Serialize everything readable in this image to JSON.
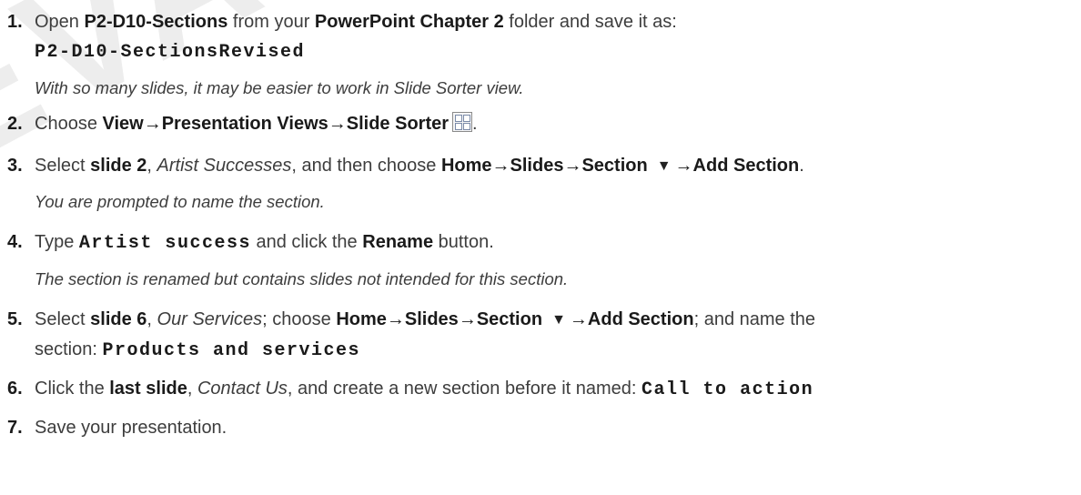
{
  "watermark": "EVALUATION",
  "steps": [
    {
      "num": "1.",
      "segments": [
        {
          "t": "Open "
        },
        {
          "t": "P2-D10-Sections",
          "b": true
        },
        {
          "t": " from your "
        },
        {
          "t": "PowerPoint Chapter 2",
          "b": true
        },
        {
          "t": " folder and save it as:"
        }
      ],
      "line2": "P2-D10-SectionsRevised",
      "note": "With so many slides, it may be easier to work in Slide Sorter view."
    },
    {
      "num": "2.",
      "segments": [
        {
          "t": "Choose "
        },
        {
          "t": "View",
          "b": true
        },
        {
          "t": "→",
          "a": true
        },
        {
          "t": "Presentation Views",
          "b": true
        },
        {
          "t": "→",
          "a": true
        },
        {
          "t": "Slide Sorter",
          "b": true
        }
      ],
      "icon": "slide-sorter-icon",
      "trailing": "."
    },
    {
      "num": "3.",
      "segments": [
        {
          "t": "Select "
        },
        {
          "t": "slide 2",
          "b": true
        },
        {
          "t": ", "
        },
        {
          "t": "Artist Successes",
          "i": true
        },
        {
          "t": ", and then choose "
        },
        {
          "t": "Home",
          "b": true
        },
        {
          "t": "→",
          "a": true
        },
        {
          "t": "Slides",
          "b": true
        },
        {
          "t": "→",
          "a": true
        },
        {
          "t": "Section",
          "b": true
        },
        {
          "t": "▼",
          "tri": true
        },
        {
          "t": "→",
          "a": true
        },
        {
          "t": "Add Section",
          "b": true
        },
        {
          "t": "."
        }
      ],
      "note": "You are prompted to name the section."
    },
    {
      "num": "4.",
      "segments": [
        {
          "t": "Type "
        },
        {
          "t": "Artist success",
          "m": true
        },
        {
          "t": " and click the "
        },
        {
          "t": "Rename",
          "b": true
        },
        {
          "t": " button."
        }
      ],
      "note": "The section is renamed but contains slides not intended for this section."
    },
    {
      "num": "5.",
      "segments": [
        {
          "t": "Select "
        },
        {
          "t": "slide 6",
          "b": true
        },
        {
          "t": ", "
        },
        {
          "t": "Our Services",
          "i": true
        },
        {
          "t": "; choose "
        },
        {
          "t": "Home",
          "b": true
        },
        {
          "t": "→",
          "a": true
        },
        {
          "t": "Slides",
          "b": true
        },
        {
          "t": "→",
          "a": true
        },
        {
          "t": "Section",
          "b": true
        },
        {
          "t": "▼",
          "tri": true
        },
        {
          "t": "→",
          "a": true
        },
        {
          "t": "Add Section",
          "b": true
        },
        {
          "t": "; and name the"
        }
      ],
      "line2_segments": [
        {
          "t": "section: "
        },
        {
          "t": "Products and services",
          "m": true
        }
      ]
    },
    {
      "num": "6.",
      "segments": [
        {
          "t": "Click the "
        },
        {
          "t": "last slide",
          "b": true
        },
        {
          "t": ", "
        },
        {
          "t": "Contact Us",
          "i": true
        },
        {
          "t": ", and create a new section before it named: "
        },
        {
          "t": "Call to action",
          "m": true
        }
      ]
    },
    {
      "num": "7.",
      "segments": [
        {
          "t": "Save your presentation."
        }
      ]
    }
  ]
}
